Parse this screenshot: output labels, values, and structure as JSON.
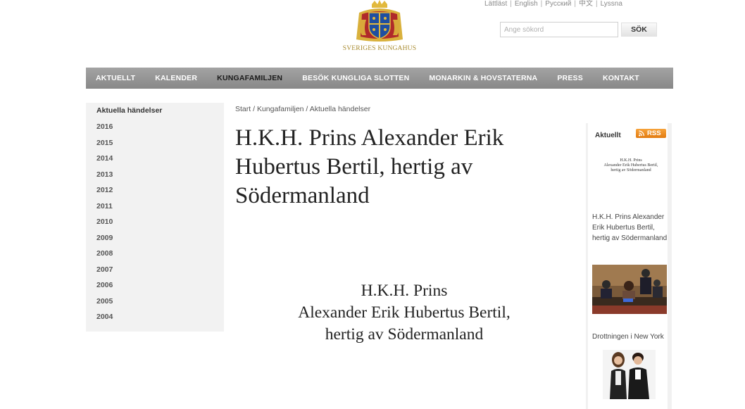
{
  "header": {
    "brand": "SVERIGES KUNGAHUS",
    "languages": [
      "Lättläst",
      "English",
      "Русский",
      "中文",
      "Lyssna"
    ],
    "search": {
      "placeholder": "Ange sökord",
      "button": "SÖK"
    }
  },
  "nav": {
    "items": [
      "AKTUELLT",
      "KALENDER",
      "KUNGAFAMILJEN",
      "BESÖK KUNGLIGA SLOTTEN",
      "MONARKIN & HOVSTATERNA",
      "PRESS",
      "KONTAKT"
    ],
    "active": "KUNGAFAMILJEN"
  },
  "sidebar": {
    "heading": "Aktuella händelser",
    "years": [
      "2016",
      "2015",
      "2014",
      "2013",
      "2012",
      "2011",
      "2010",
      "2009",
      "2008",
      "2007",
      "2006",
      "2005",
      "2004"
    ]
  },
  "breadcrumb": [
    "Start",
    "Kungafamiljen",
    "Aktuella händelser"
  ],
  "main": {
    "title": "H.K.H. Prins Alexander Erik Hubertus Bertil, hertig av Södermanland",
    "image_text": [
      "H.K.H. Prins",
      "Alexander Erik Hubertus Bertil,",
      "hertig av Södermanland"
    ]
  },
  "news": {
    "heading": "Aktuellt",
    "rss": "RSS",
    "thumb_text": [
      "H.K.H. Prins",
      "Alexander Erik Hubertus Bertil,",
      "hertig av Södermanland"
    ],
    "items": [
      {
        "title": "H.K.H. Prins Alexander Erik Hubertus Bertil, hertig av Södermanland"
      },
      {
        "title": "Drottningen i New York"
      }
    ]
  },
  "colors": {
    "nav_bar": "#999999",
    "gold": "#a88a2e",
    "rss_orange": "#f0902a",
    "sidebar_bg": "#f2f2f2"
  }
}
